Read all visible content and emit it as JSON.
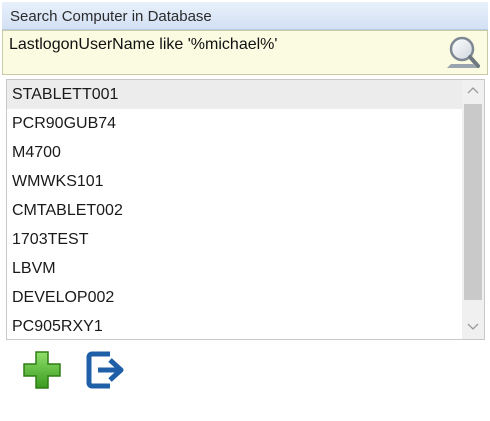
{
  "window": {
    "title": "Search Computer in Database"
  },
  "search": {
    "query": "LastlogonUserName like '%michael%'",
    "button_icon": "magnifier-icon"
  },
  "results": {
    "items": [
      "STABLETT001",
      "PCR90GUB74",
      "M4700",
      "WMWKS101",
      "CMTABLET002",
      "1703TEST",
      "LBVM",
      "DEVELOP002",
      "PC905RXY1"
    ],
    "selected_index": 0
  },
  "toolbar": {
    "add_icon": "green-plus-icon",
    "exit_icon": "exit-arrow-icon"
  },
  "colors": {
    "title_bar": "#d9e6f6",
    "search_background": "#fbfbe2",
    "selected_row": "#ececec",
    "add_green": "#4caf2a",
    "exit_blue": "#1f5fa8"
  }
}
